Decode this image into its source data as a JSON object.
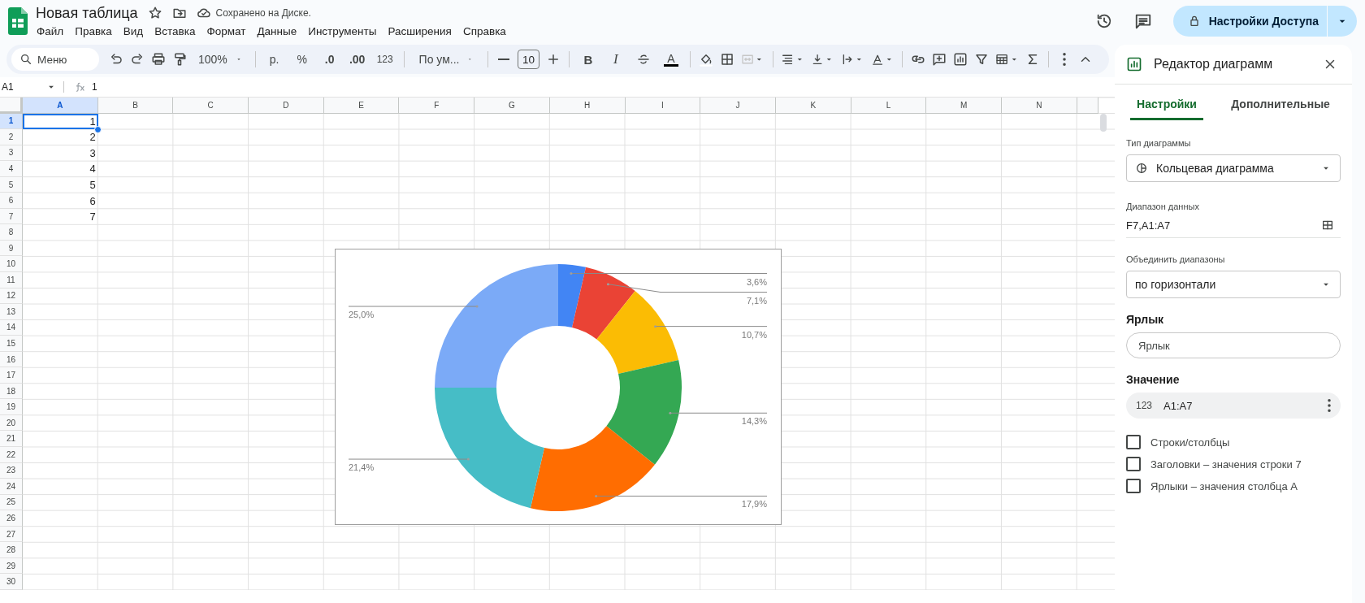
{
  "app": {
    "title": "Новая таблица",
    "save_status": "Сохранено на Диске.",
    "share_button": "Настройки Доступа"
  },
  "menu": [
    "Файл",
    "Правка",
    "Вид",
    "Вставка",
    "Формат",
    "Данные",
    "Инструменты",
    "Расширения",
    "Справка"
  ],
  "toolbar": {
    "search_placeholder": "Меню",
    "zoom": "100%",
    "currency": "р.",
    "percent": "%",
    "decrease_decimals": ".0",
    "increase_decimals": ".00",
    "number_format": "123",
    "font": "По ум...",
    "font_size": "10",
    "bold": "B",
    "italic": "I",
    "text_color": "A"
  },
  "formula_bar": {
    "cell_ref": "A1",
    "formula": "1"
  },
  "sheet": {
    "columns": [
      {
        "label": "A",
        "selected": true
      },
      {
        "label": "B",
        "selected": false
      },
      {
        "label": "C",
        "selected": false
      },
      {
        "label": "D",
        "selected": false
      },
      {
        "label": "E",
        "selected": false
      },
      {
        "label": "F",
        "selected": false
      },
      {
        "label": "G",
        "selected": false
      },
      {
        "label": "H",
        "selected": false
      },
      {
        "label": "I",
        "selected": false
      },
      {
        "label": "J",
        "selected": false
      },
      {
        "label": "K",
        "selected": false
      },
      {
        "label": "L",
        "selected": false
      },
      {
        "label": "M",
        "selected": false
      },
      {
        "label": "N",
        "selected": false
      }
    ],
    "rows": [
      {
        "number": "1",
        "selected": true,
        "cells": [
          "1"
        ]
      },
      {
        "number": "2",
        "selected": false,
        "cells": [
          "2"
        ]
      },
      {
        "number": "3",
        "selected": false,
        "cells": [
          "3"
        ]
      },
      {
        "number": "4",
        "selected": false,
        "cells": [
          "4"
        ]
      },
      {
        "number": "5",
        "selected": false,
        "cells": [
          "5"
        ]
      },
      {
        "number": "6",
        "selected": false,
        "cells": [
          "6"
        ]
      },
      {
        "number": "7",
        "selected": false,
        "cells": [
          "7"
        ]
      },
      {
        "number": "8",
        "selected": false,
        "cells": []
      },
      {
        "number": "9",
        "selected": false,
        "cells": []
      },
      {
        "number": "10",
        "selected": false,
        "cells": []
      },
      {
        "number": "11",
        "selected": false,
        "cells": []
      },
      {
        "number": "12",
        "selected": false,
        "cells": []
      },
      {
        "number": "13",
        "selected": false,
        "cells": []
      },
      {
        "number": "14",
        "selected": false,
        "cells": []
      },
      {
        "number": "15",
        "selected": false,
        "cells": []
      },
      {
        "number": "16",
        "selected": false,
        "cells": []
      },
      {
        "number": "17",
        "selected": false,
        "cells": []
      },
      {
        "number": "18",
        "selected": false,
        "cells": []
      },
      {
        "number": "19",
        "selected": false,
        "cells": []
      },
      {
        "number": "20",
        "selected": false,
        "cells": []
      },
      {
        "number": "21",
        "selected": false,
        "cells": []
      },
      {
        "number": "22",
        "selected": false,
        "cells": []
      },
      {
        "number": "23",
        "selected": false,
        "cells": []
      },
      {
        "number": "24",
        "selected": false,
        "cells": []
      },
      {
        "number": "25",
        "selected": false,
        "cells": []
      },
      {
        "number": "26",
        "selected": false,
        "cells": []
      },
      {
        "number": "27",
        "selected": false,
        "cells": []
      },
      {
        "number": "28",
        "selected": false,
        "cells": []
      },
      {
        "number": "29",
        "selected": false,
        "cells": []
      },
      {
        "number": "30",
        "selected": false,
        "cells": []
      }
    ],
    "chart": {
      "chart_data": {
        "type": "donut",
        "values": [
          3.6,
          7.1,
          10.7,
          14.3,
          17.9,
          21.4,
          25.0
        ],
        "colors": [
          "#4285f4",
          "#ea4335",
          "#fbbc04",
          "#34a853",
          "#ff6d01",
          "#46bdc6",
          "#7baaf7"
        ],
        "data_labels": true,
        "value_labels": [
          "3,6%",
          "7,1%",
          "10,7%",
          "14,3%",
          "17,9%",
          "21,4%",
          "25,0%"
        ]
      }
    }
  },
  "chart_editor": {
    "title": "Редактор диаграмм",
    "tabs": [
      {
        "label": "Настройки",
        "selected": true
      },
      {
        "label": "Дополнительные",
        "selected": false
      }
    ],
    "chart_type": {
      "label": "Тип диаграммы",
      "value": "Кольцевая диаграмма"
    },
    "data_range": {
      "label": "Диапазон данных",
      "value": "F7,A1:A7"
    },
    "combine_ranges": {
      "label": "Объединить диапазоны",
      "value": "по горизонтали"
    },
    "label_section": {
      "heading": "Ярлык",
      "placeholder": "Ярлык"
    },
    "value_section": {
      "heading": "Значение",
      "type": "123",
      "range": "A1:A7"
    },
    "checkboxes": [
      {
        "label": "Строки/столбцы",
        "checked": false
      },
      {
        "label": "Заголовки – значения строки 7",
        "checked": false
      },
      {
        "label": "Ярлыки – значения столбца A",
        "checked": false
      }
    ]
  }
}
